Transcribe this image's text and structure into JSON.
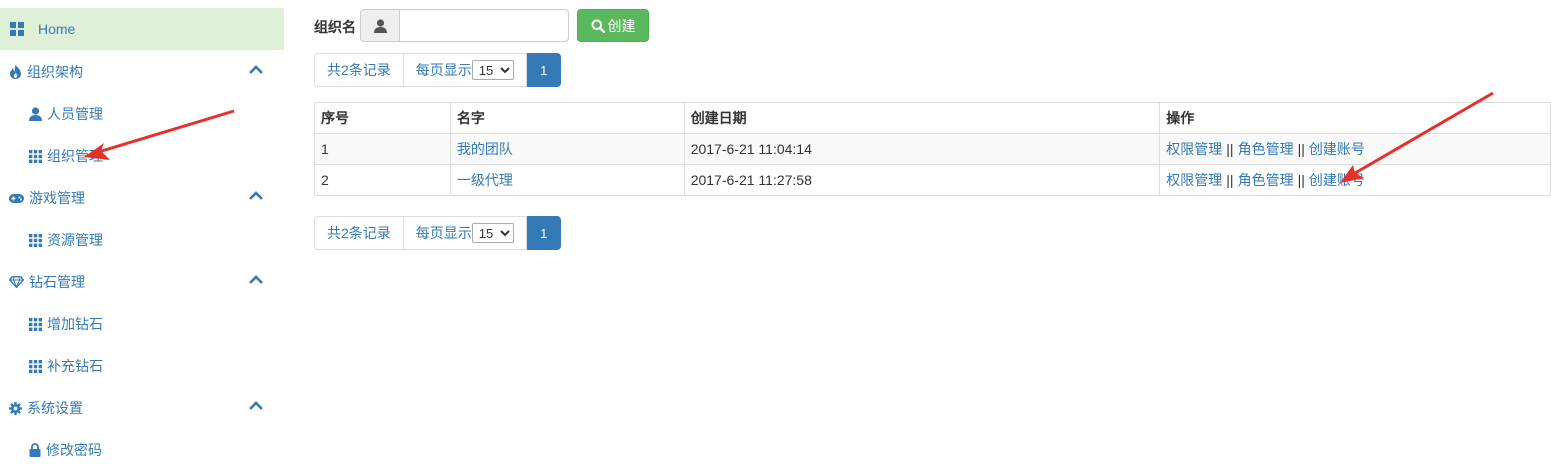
{
  "sidebar": {
    "home": {
      "label": "Home",
      "icon": "dashboard-grid-icon"
    },
    "groups": [
      {
        "label": "组织架构",
        "icon": "fire-icon",
        "items": [
          {
            "label": "人员管理",
            "icon": "user-icon"
          },
          {
            "label": "组织管理",
            "icon": "grid-icon"
          }
        ]
      },
      {
        "label": "游戏管理",
        "icon": "gamepad-icon",
        "items": [
          {
            "label": "资源管理",
            "icon": "grid-icon"
          }
        ]
      },
      {
        "label": "钻石管理",
        "icon": "diamond-icon",
        "items": [
          {
            "label": "增加钻石",
            "icon": "grid-icon"
          },
          {
            "label": "补充钻石",
            "icon": "grid-icon"
          }
        ]
      },
      {
        "label": "系统设置",
        "icon": "gear-icon",
        "items": [
          {
            "label": "修改密码",
            "icon": "lock-icon"
          }
        ]
      }
    ]
  },
  "form": {
    "label": "组织名",
    "input_value": "",
    "input_placeholder": "",
    "create_button": "创建"
  },
  "pager": {
    "total_prefix": "共",
    "total_count": "2",
    "total_suffix": "条记录",
    "per_page_label": "每页显示",
    "per_page_value": "15",
    "current_page": "1"
  },
  "table": {
    "headers": [
      "序号",
      "名字",
      "创建日期",
      "操作"
    ],
    "rows": [
      {
        "index": "1",
        "name": "我的团队",
        "date": "2017-6-21 11:04:14"
      },
      {
        "index": "2",
        "name": "一级代理",
        "date": "2017-6-21 11:27:58"
      }
    ],
    "actions": [
      "权限管理",
      "角色管理",
      "创建账号"
    ],
    "action_separator": "||"
  },
  "colors": {
    "link": "#337ab7",
    "home_bg": "#dff0d8",
    "create_button": "#5cb85c",
    "page_active": "#337ab7",
    "annotation_arrow": "#e8302a"
  }
}
